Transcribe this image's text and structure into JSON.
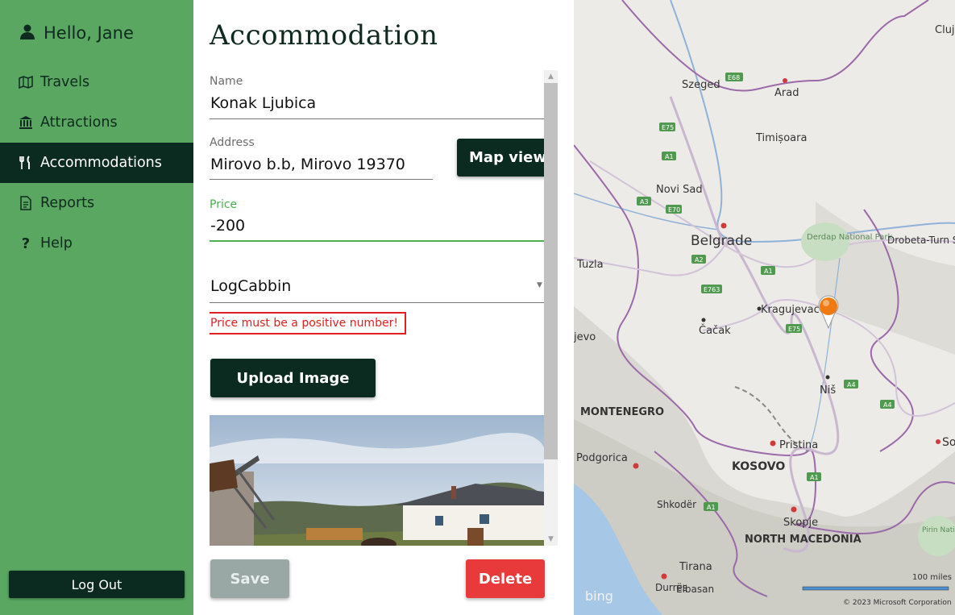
{
  "sidebar": {
    "greeting": "Hello, Jane",
    "items": [
      {
        "label": "Travels",
        "icon": "map-icon",
        "active": false
      },
      {
        "label": "Attractions",
        "icon": "landmark-icon",
        "active": false
      },
      {
        "label": "Accommodations",
        "icon": "utensils-icon",
        "active": true
      },
      {
        "label": "Reports",
        "icon": "report-icon",
        "active": false
      },
      {
        "label": "Help",
        "icon": "question-icon",
        "active": false
      }
    ],
    "logout_label": "Log Out"
  },
  "form": {
    "title": "Accommodation",
    "name_label": "Name",
    "name_value": "Konak Ljubica",
    "address_label": "Address",
    "address_value": "Mirovo b.b, Mirovo 19370",
    "map_view_label": "Map view",
    "price_label": "Price",
    "price_value": "-200",
    "type_value": "LogCabbin",
    "error_text": "Price must be a positive number!",
    "upload_label": "Upload Image",
    "save_label": "Save",
    "delete_label": "Delete"
  },
  "map": {
    "cities": [
      {
        "name": "Cluj-N"
      },
      {
        "name": "Szeged"
      },
      {
        "name": "Arad"
      },
      {
        "name": "Timișoara"
      },
      {
        "name": "Novi Sad"
      },
      {
        "name": "Belgrade"
      },
      {
        "name": "Derdap National Park"
      },
      {
        "name": "Drobeta-Turn Severin"
      },
      {
        "name": "Tuzla"
      },
      {
        "name": "Kragujevac"
      },
      {
        "name": "Čačak"
      },
      {
        "name": "jevo"
      },
      {
        "name": "Niš"
      },
      {
        "name": "MONTENEGRO"
      },
      {
        "name": "Pristina"
      },
      {
        "name": "KOSOVO"
      },
      {
        "name": "Podgorica"
      },
      {
        "name": "So"
      },
      {
        "name": "Shkodër"
      },
      {
        "name": "Skopje"
      },
      {
        "name": "NORTH MACEDONIA"
      },
      {
        "name": "Pirin National Park"
      },
      {
        "name": "Tirana"
      },
      {
        "name": "Durrës"
      },
      {
        "name": "Elbasan"
      }
    ],
    "road_shields": [
      "E68",
      "E75",
      "A1",
      "A3",
      "E70",
      "A2",
      "E763",
      "A1",
      "E75",
      "A4",
      "A4",
      "A1",
      "A1"
    ],
    "scale_label": "100 miles",
    "copyright": "© 2023 Microsoft Corporation",
    "provider": "bing"
  },
  "colors": {
    "sidebar_bg": "#59a760",
    "dark": "#0c2b20",
    "error": "#e02020",
    "delete": "#e83a3a",
    "save_disabled": "#9aa8a5",
    "price_accent": "#4caf50"
  }
}
